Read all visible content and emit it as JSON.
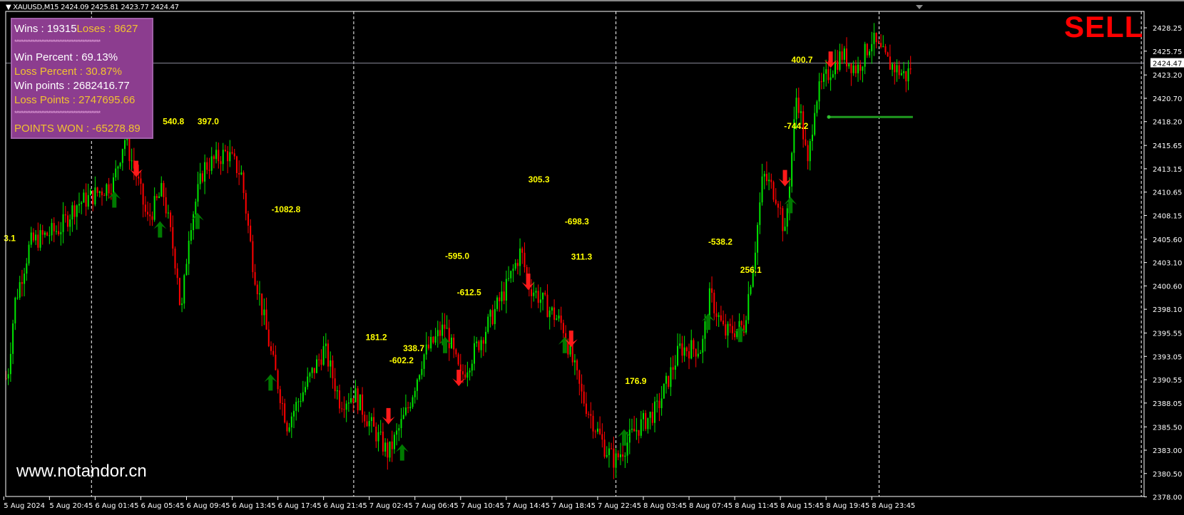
{
  "header": {
    "symbol": "XAUUSD,M15",
    "ohlc": "2424.09 2425.81 2423.77 2424.47"
  },
  "stats_panel": {
    "wins": "Wins  : 19315",
    "loses": "Loses : 8627",
    "stars": "************************************************",
    "win_percent": "Win Percent  :  69.13%",
    "loss_percent": "Loss Percent :  30.87%",
    "win_points": "Win points  : 2682416.77",
    "loss_points": "Loss Points : 2747695.66",
    "points_won": "POINTS WON : -65278.89"
  },
  "signal": "SELL",
  "watermark": "www.notandor.cn",
  "colors": {
    "bull": "#00e600",
    "bear": "#ff0000",
    "label": "#ffff00",
    "panel": "#8c3d8f",
    "up_arrow": "#007a00",
    "down_arrow": "#ff1a1a"
  },
  "chart_data": {
    "type": "candlestick",
    "title": "XAUUSD,M15",
    "x_unit": "hours since 5 Aug 2024 15:45",
    "ylim": [
      2378.0,
      2430.6
    ],
    "current_price": 2424.47,
    "y_ticks": [
      "2428.25",
      "2425.75",
      "2423.20",
      "2420.70",
      "2418.20",
      "2415.65",
      "2413.15",
      "2410.65",
      "2408.15",
      "2405.60",
      "2403.10",
      "2400.60",
      "2398.10",
      "2395.55",
      "2393.05",
      "2390.55",
      "2388.05",
      "2385.50",
      "2383.00",
      "2380.50",
      "2378.00"
    ],
    "x_ticks": [
      "5 Aug 2024",
      "5 Aug 20:45",
      "6 Aug 01:45",
      "6 Aug 05:45",
      "6 Aug 09:45",
      "6 Aug 13:45",
      "6 Aug 17:45",
      "6 Aug 21:45",
      "7 Aug 02:45",
      "7 Aug 06:45",
      "7 Aug 10:45",
      "7 Aug 14:45",
      "7 Aug 18:45",
      "7 Aug 22:45",
      "8 Aug 03:45",
      "8 Aug 07:45",
      "8 Aug 11:45",
      "8 Aug 15:45",
      "8 Aug 19:45",
      "8 Aug 23:45"
    ],
    "day_separators_hours": [
      9.6,
      38.3,
      67.0,
      95.8,
      124.5
    ],
    "price_path": [
      [
        0.4,
        2390.7
      ],
      [
        1.2,
        2398.8
      ],
      [
        2.9,
        2405.2
      ],
      [
        6.2,
        2406.8
      ],
      [
        7.9,
        2409.3
      ],
      [
        9.5,
        2410.1
      ],
      [
        12.0,
        2411.7
      ],
      [
        13.2,
        2416.5
      ],
      [
        14.5,
        2412.5
      ],
      [
        15.7,
        2407.6
      ],
      [
        17.4,
        2410.9
      ],
      [
        19.0,
        2402.0
      ],
      [
        19.4,
        2397.1
      ],
      [
        20.3,
        2406.8
      ],
      [
        21.9,
        2413.3
      ],
      [
        24.4,
        2414.9
      ],
      [
        26.0,
        2412.5
      ],
      [
        27.3,
        2402.8
      ],
      [
        29.3,
        2393.1
      ],
      [
        31.0,
        2385.8
      ],
      [
        32.6,
        2389.0
      ],
      [
        35.1,
        2393.9
      ],
      [
        36.8,
        2388.2
      ],
      [
        38.4,
        2389.0
      ],
      [
        40.1,
        2385.8
      ],
      [
        42.1,
        2382.6
      ],
      [
        44.2,
        2387.4
      ],
      [
        45.9,
        2393.1
      ],
      [
        48.3,
        2396.3
      ],
      [
        50.0,
        2390.7
      ],
      [
        52.5,
        2395.5
      ],
      [
        55.0,
        2400.4
      ],
      [
        56.6,
        2404.4
      ],
      [
        57.4,
        2400.8
      ],
      [
        59.1,
        2398.8
      ],
      [
        61.2,
        2396.3
      ],
      [
        63.2,
        2389.0
      ],
      [
        65.7,
        2383.4
      ],
      [
        66.9,
        2381.8
      ],
      [
        69.0,
        2385.0
      ],
      [
        71.5,
        2387.4
      ],
      [
        74.0,
        2393.9
      ],
      [
        76.4,
        2393.9
      ],
      [
        77.3,
        2399.6
      ],
      [
        78.9,
        2395.5
      ],
      [
        81.0,
        2396.3
      ],
      [
        82.2,
        2404.4
      ],
      [
        83.1,
        2412.5
      ],
      [
        84.7,
        2410.1
      ],
      [
        85.5,
        2406.0
      ],
      [
        86.8,
        2421.4
      ],
      [
        87.2,
        2419.0
      ],
      [
        88.0,
        2413.3
      ],
      [
        88.8,
        2420.6
      ],
      [
        90.5,
        2423.8
      ],
      [
        91.7,
        2425.4
      ],
      [
        93.4,
        2423.8
      ],
      [
        95.0,
        2427.0
      ],
      [
        96.7,
        2424.6
      ],
      [
        98.8,
        2423.0
      ],
      [
        99.4,
        2424.47
      ]
    ],
    "annotations": [
      {
        "text": "3.1",
        "t": 0.0,
        "price": 2405.4
      },
      {
        "text": "540.8",
        "t": 17.4,
        "price": 2417.9
      },
      {
        "text": "397.0",
        "t": 21.2,
        "price": 2417.9
      },
      {
        "text": "-1082.8",
        "t": 29.3,
        "price": 2408.5
      },
      {
        "text": "305.3",
        "t": 57.4,
        "price": 2411.7
      },
      {
        "text": "-698.3",
        "t": 61.4,
        "price": 2407.2
      },
      {
        "text": "-595.0",
        "t": 48.3,
        "price": 2403.5
      },
      {
        "text": "311.3",
        "t": 62.1,
        "price": 2403.4
      },
      {
        "text": "-612.5",
        "t": 49.6,
        "price": 2399.6
      },
      {
        "text": "181.2",
        "t": 39.6,
        "price": 2394.8
      },
      {
        "text": "338.7",
        "t": 43.7,
        "price": 2393.6
      },
      {
        "text": "-602.2",
        "t": 42.2,
        "price": 2392.3
      },
      {
        "text": "176.9",
        "t": 68.0,
        "price": 2390.1
      },
      {
        "text": "-538.2",
        "t": 77.1,
        "price": 2405.0
      },
      {
        "text": "256.1",
        "t": 80.6,
        "price": 2402.0
      },
      {
        "text": "400.7",
        "t": 86.2,
        "price": 2424.5
      },
      {
        "text": "-744.2",
        "t": 85.4,
        "price": 2417.4
      }
    ],
    "buy_arrows": [
      [
        12.1,
        2409.9
      ],
      [
        17.1,
        2406.7
      ],
      [
        21.2,
        2407.6
      ],
      [
        29.2,
        2390.3
      ],
      [
        43.6,
        2382.8
      ],
      [
        48.3,
        2394.3
      ],
      [
        61.4,
        2394.3
      ],
      [
        67.9,
        2384.4
      ],
      [
        77.1,
        2396.8
      ],
      [
        80.6,
        2395.5
      ],
      [
        86.1,
        2409.3
      ]
    ],
    "sell_arrows": [
      [
        14.5,
        2413.1
      ],
      [
        42.1,
        2386.6
      ],
      [
        49.8,
        2390.7
      ],
      [
        57.4,
        2401.0
      ],
      [
        62.1,
        2394.9
      ],
      [
        85.5,
        2412.1
      ],
      [
        90.5,
        2424.8
      ]
    ],
    "level_line": {
      "t_start": 90.3,
      "t_end": 99.5,
      "price": 2418.7
    }
  }
}
